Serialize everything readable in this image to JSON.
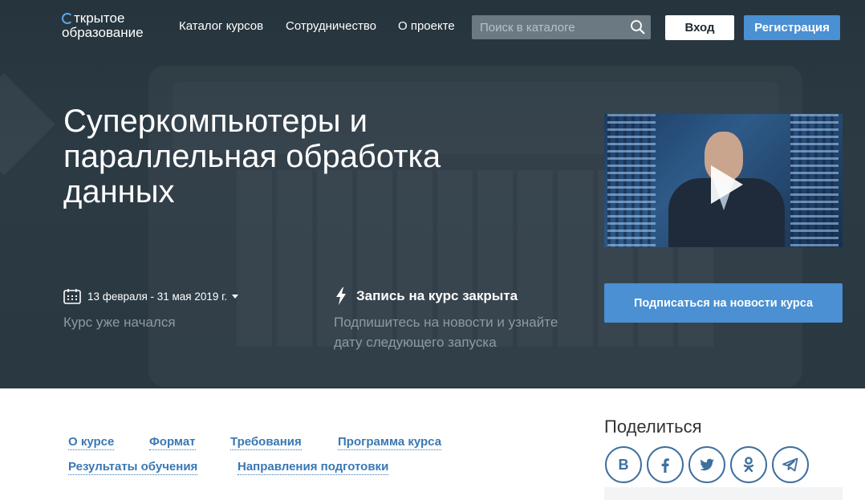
{
  "header": {
    "logo_line1": "ткрытое",
    "logo_line2": "образование",
    "nav": [
      "Каталог курсов",
      "Сотрудничество",
      "О проекте"
    ],
    "search_placeholder": "Поиск в каталоге",
    "login_label": "Вход",
    "register_label": "Регистрация"
  },
  "course": {
    "title": "Суперкомпьютеры и параллельная обработка данных",
    "dates": "13 февраля - 31 мая 2019 г.",
    "started_note": "Курс уже начался",
    "enrollment_status": "Запись на курс закрыта",
    "enrollment_hint": "Подпишитесь на новости и узнайте дату следующего запуска",
    "subscribe_label": "Подписаться на новости курса"
  },
  "sections": {
    "row1": [
      "О курсе",
      "Формат",
      "Требования",
      "Программа курса"
    ],
    "row2": [
      "Результаты обучения",
      "Направления подготовки"
    ]
  },
  "share": {
    "title": "Поделиться",
    "icons": [
      "vk-icon",
      "facebook-icon",
      "twitter-icon",
      "odnoklassniki-icon",
      "telegram-icon"
    ]
  },
  "colors": {
    "hero_bg": "#2a3842",
    "accent": "#4a90d2",
    "link": "#3a78b4",
    "social": "#3e6f9f"
  }
}
